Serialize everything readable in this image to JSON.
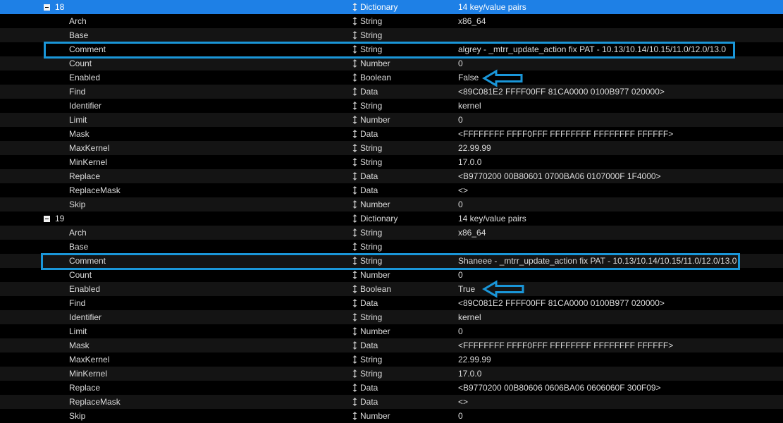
{
  "colors": {
    "selection": "#1e80e6",
    "highlight": "#1a96d8",
    "row_alt": "#141414",
    "text": "#dcdcdc"
  },
  "icons": {
    "collapse": "minus-box-icon",
    "sort": "updown-arrows-icon",
    "annotation": "left-arrow-icon"
  },
  "groups": [
    {
      "index": "18",
      "type": "Dictionary",
      "value": "14 key/value pairs",
      "rows": [
        {
          "key": "Arch",
          "type": "String",
          "value": "x86_64"
        },
        {
          "key": "Base",
          "type": "String",
          "value": ""
        },
        {
          "key": "Comment",
          "type": "String",
          "value": "algrey - _mtrr_update_action fix PAT - 10.13/10.14/10.15/11.0/12.0/13.0"
        },
        {
          "key": "Count",
          "type": "Number",
          "value": "0"
        },
        {
          "key": "Enabled",
          "type": "Boolean",
          "value": "False"
        },
        {
          "key": "Find",
          "type": "Data",
          "value": "<89C081E2 FFFF00FF 81CA0000 0100B977 020000>"
        },
        {
          "key": "Identifier",
          "type": "String",
          "value": "kernel"
        },
        {
          "key": "Limit",
          "type": "Number",
          "value": "0"
        },
        {
          "key": "Mask",
          "type": "Data",
          "value": "<FFFFFFFF FFFF0FFF FFFFFFFF FFFFFFFF FFFFFF>"
        },
        {
          "key": "MaxKernel",
          "type": "String",
          "value": "22.99.99"
        },
        {
          "key": "MinKernel",
          "type": "String",
          "value": "17.0.0"
        },
        {
          "key": "Replace",
          "type": "Data",
          "value": "<B9770200 00B80601 0700BA06 0107000F 1F4000>"
        },
        {
          "key": "ReplaceMask",
          "type": "Data",
          "value": "<>"
        },
        {
          "key": "Skip",
          "type": "Number",
          "value": "0"
        }
      ]
    },
    {
      "index": "19",
      "type": "Dictionary",
      "value": "14 key/value pairs",
      "rows": [
        {
          "key": "Arch",
          "type": "String",
          "value": "x86_64"
        },
        {
          "key": "Base",
          "type": "String",
          "value": ""
        },
        {
          "key": "Comment",
          "type": "String",
          "value": "Shaneee - _mtrr_update_action fix PAT - 10.13/10.14/10.15/11.0/12.0/13.0"
        },
        {
          "key": "Count",
          "type": "Number",
          "value": "0"
        },
        {
          "key": "Enabled",
          "type": "Boolean",
          "value": "True"
        },
        {
          "key": "Find",
          "type": "Data",
          "value": "<89C081E2 FFFF00FF 81CA0000 0100B977 020000>"
        },
        {
          "key": "Identifier",
          "type": "String",
          "value": "kernel"
        },
        {
          "key": "Limit",
          "type": "Number",
          "value": "0"
        },
        {
          "key": "Mask",
          "type": "Data",
          "value": "<FFFFFFFF FFFF0FFF FFFFFFFF FFFFFFFF FFFFFF>"
        },
        {
          "key": "MaxKernel",
          "type": "String",
          "value": "22.99.99"
        },
        {
          "key": "MinKernel",
          "type": "String",
          "value": "17.0.0"
        },
        {
          "key": "Replace",
          "type": "Data",
          "value": "<B9770200 00B80606 0606BA06 0606060F 300F09>"
        },
        {
          "key": "ReplaceMask",
          "type": "Data",
          "value": "<>"
        },
        {
          "key": "Skip",
          "type": "Number",
          "value": "0"
        }
      ]
    }
  ]
}
